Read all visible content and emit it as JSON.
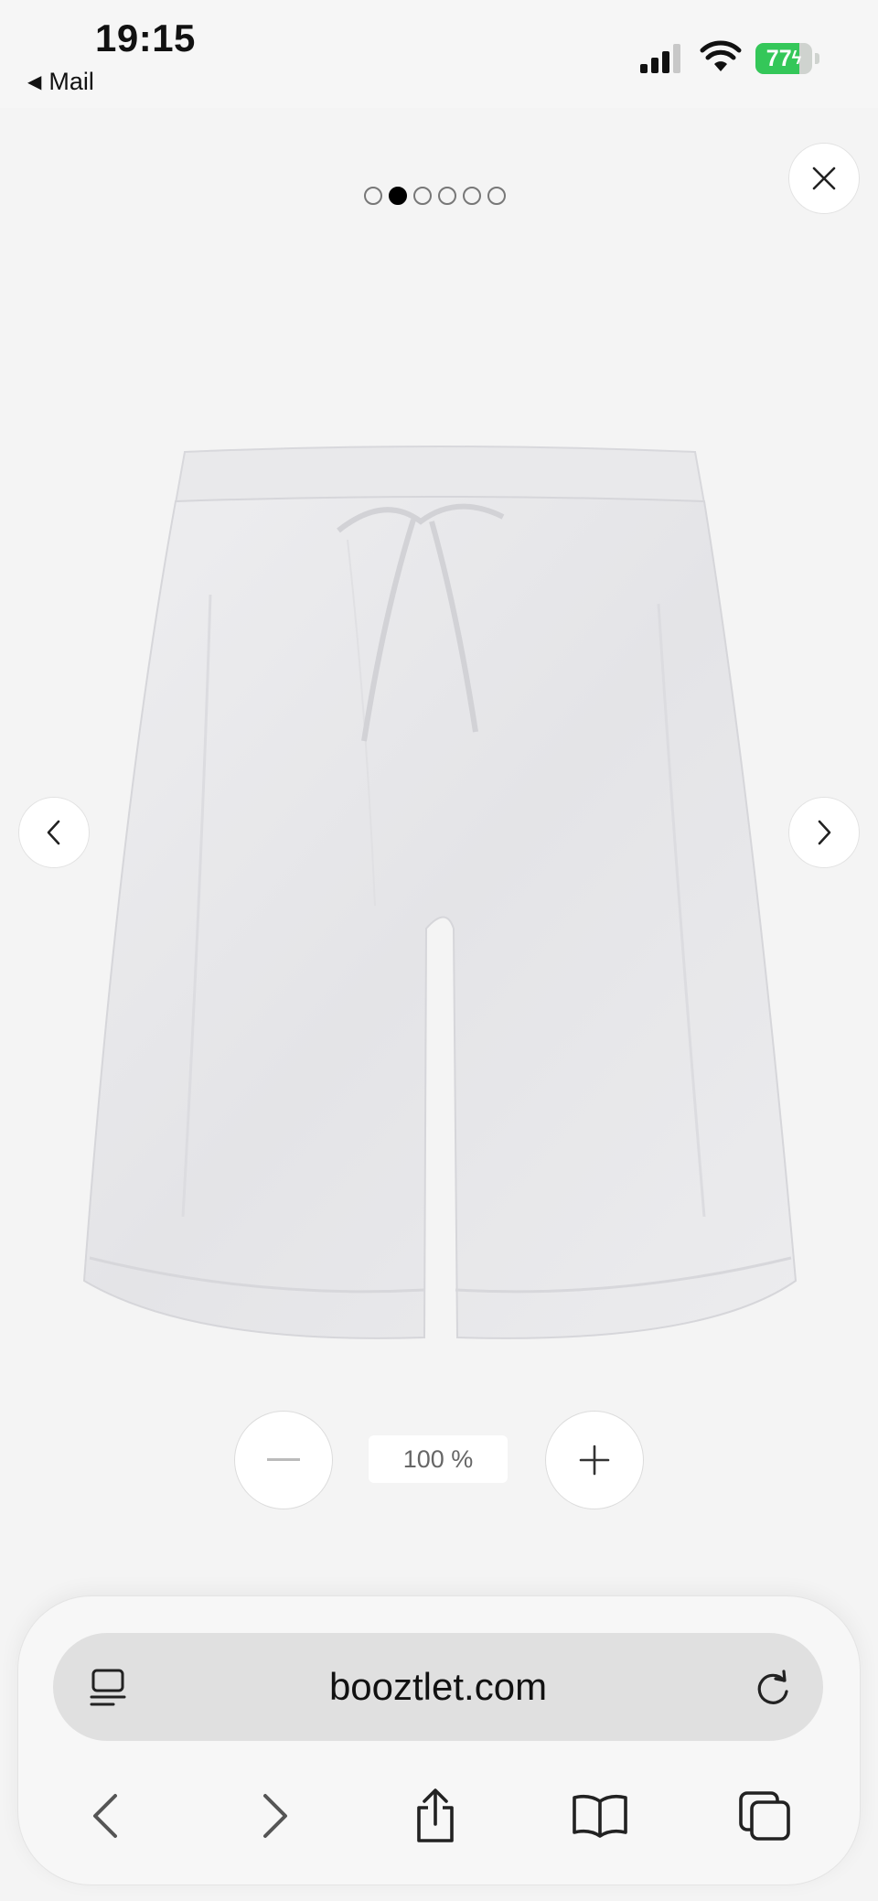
{
  "status_bar": {
    "time": "19:15",
    "back_app_label": "Mail",
    "battery_level": "77",
    "battery_fraction": 0.77,
    "icons": [
      "signal-icon",
      "wifi-icon",
      "battery-charging-icon"
    ]
  },
  "gallery": {
    "total_images": 6,
    "active_index": 1,
    "image_subject": "white linen shorts product photo",
    "icons": [
      "close-icon",
      "chevron-left-icon",
      "chevron-right-icon"
    ]
  },
  "zoom": {
    "level": "100 %",
    "icons": [
      "zoom-out-icon",
      "zoom-in-icon"
    ]
  },
  "browser": {
    "url": "booztlet.com",
    "icons": [
      "reader-icon",
      "reload-icon",
      "back-icon",
      "forward-icon",
      "share-icon",
      "bookmarks-icon",
      "tabs-icon"
    ]
  },
  "colors": {
    "page_background": "#f4f4f4",
    "battery_green": "#34c759",
    "active_dot": "#000000"
  }
}
